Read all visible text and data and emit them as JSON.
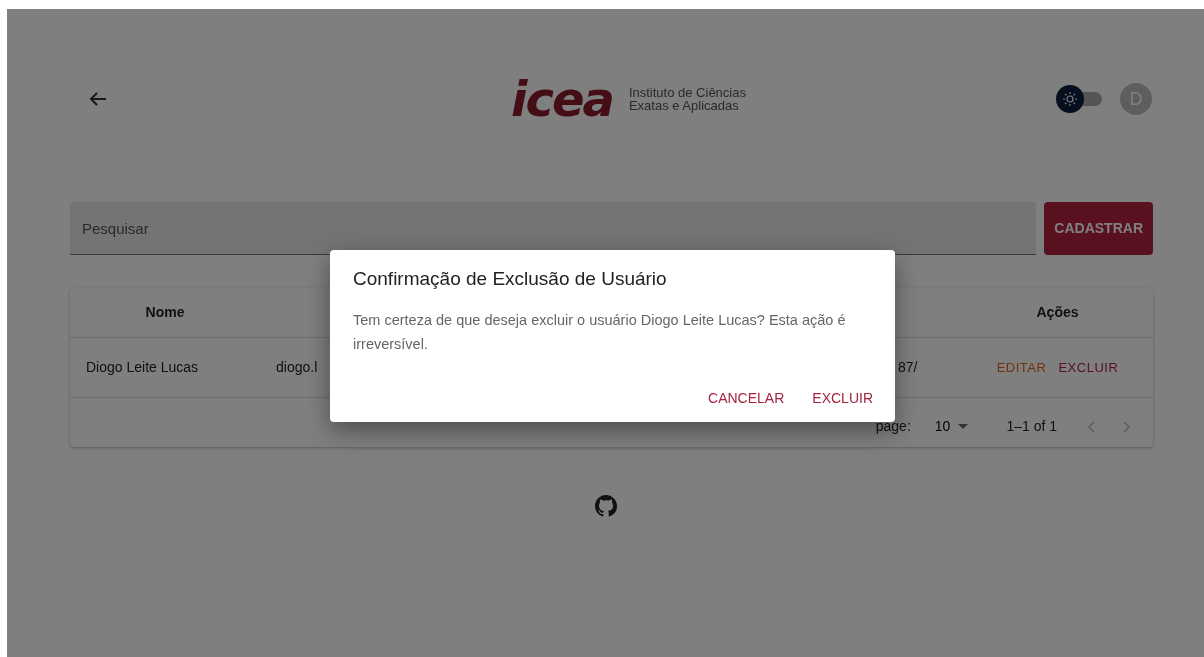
{
  "header": {
    "logo_text": "icea",
    "institute": [
      "Instituto de Ciências",
      "Exatas e Aplicadas"
    ],
    "theme_toggle": {
      "on": false
    },
    "avatar": "D"
  },
  "search": {
    "placeholder": "Pesquisar"
  },
  "add_button": "CADASTRAR",
  "table": {
    "columns": [
      {
        "label": "Nome"
      },
      {
        "label": "Ações"
      }
    ],
    "rows": [
      {
        "cells": [
          "Diogo Leite Lucas",
          "diogo.l",
          "",
          "87/"
        ],
        "actions": [
          {
            "label": "EDITAR",
            "kind": "edit"
          },
          {
            "label": "EXCLUIR",
            "kind": "delete"
          }
        ]
      }
    ],
    "footer": {
      "rows_label": "page:",
      "rows_value": "10",
      "range": "1–1 of 1",
      "prev_disabled": true,
      "next_disabled": true
    }
  },
  "dialog": {
    "title": "Confirmação de Exclusão de Usuário",
    "message": "Tem certeza de que deseja excluir o usuário Diogo Leite Lucas? Esta ação é irreversível.",
    "buttons": [
      "CANCELAR",
      "EXCLUIR"
    ]
  }
}
